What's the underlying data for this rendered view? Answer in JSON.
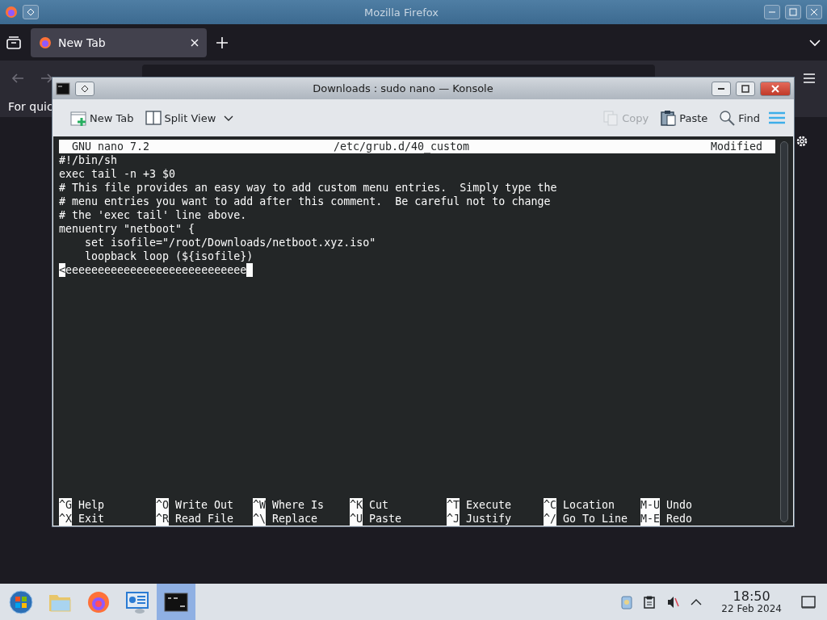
{
  "firefox": {
    "title": "Mozilla Firefox",
    "tabs": [
      {
        "label": "New Tab",
        "selected": true
      }
    ],
    "bookmarks_text": "For quic"
  },
  "konsole": {
    "title": "Downloads : sudo nano — Konsole",
    "toolbar": [
      {
        "kind": "new-tab",
        "label": "New Tab",
        "disabled": false
      },
      {
        "kind": "split-view",
        "label": "Split View",
        "disabled": false
      },
      {
        "kind": "copy",
        "label": "Copy",
        "disabled": true
      },
      {
        "kind": "paste",
        "label": "Paste",
        "disabled": false
      },
      {
        "kind": "find",
        "label": "Find",
        "disabled": false
      }
    ],
    "nano": {
      "version": "GNU nano 7.2",
      "file": "/etc/grub.d/40_custom",
      "status": "Modified",
      "lines": [
        {
          "text": "#!/bin/sh",
          "cursor": false
        },
        {
          "text": "exec tail -n +3 $0",
          "cursor": false
        },
        {
          "text": "# This file provides an easy way to add custom menu entries.  Simply type the",
          "cursor": false
        },
        {
          "text": "# menu entries you want to add after this comment.  Be careful not to change",
          "cursor": false
        },
        {
          "text": "# the 'exec tail' line above.",
          "cursor": false
        },
        {
          "text": "menuentry \"netboot\" {",
          "cursor": false
        },
        {
          "text": "    set isofile=\"/root/Downloads/netboot.xyz.iso\"",
          "cursor": false
        },
        {
          "text": "    loopback loop (${isofile})",
          "cursor": false
        },
        {
          "marker": "<",
          "text": "eeeeeeeeeeeeeeeeeeeeeeeeeeee",
          "cursor": true
        }
      ],
      "shortcuts": [
        [
          {
            "key": "^G",
            "label": "Help"
          },
          {
            "key": "^O",
            "label": "Write Out"
          },
          {
            "key": "^W",
            "label": "Where Is"
          },
          {
            "key": "^K",
            "label": "Cut"
          },
          {
            "key": "^T",
            "label": "Execute"
          },
          {
            "key": "^C",
            "label": "Location"
          },
          {
            "key": "M-U",
            "label": "Undo"
          }
        ],
        [
          {
            "key": "^X",
            "label": "Exit"
          },
          {
            "key": "^R",
            "label": "Read File"
          },
          {
            "key": "^\\",
            "label": "Replace"
          },
          {
            "key": "^U",
            "label": "Paste"
          },
          {
            "key": "^J",
            "label": "Justify"
          },
          {
            "key": "^/",
            "label": "Go To Line"
          },
          {
            "key": "M-E",
            "label": "Redo"
          }
        ]
      ]
    }
  },
  "taskbar": {
    "apps": [
      {
        "kind": "start",
        "selected": false
      },
      {
        "kind": "files",
        "selected": false
      },
      {
        "kind": "firefox",
        "selected": false
      },
      {
        "kind": "settings",
        "selected": false
      },
      {
        "kind": "terminal",
        "selected": true
      }
    ],
    "time": "18:50",
    "date": "22 Feb 2024"
  }
}
